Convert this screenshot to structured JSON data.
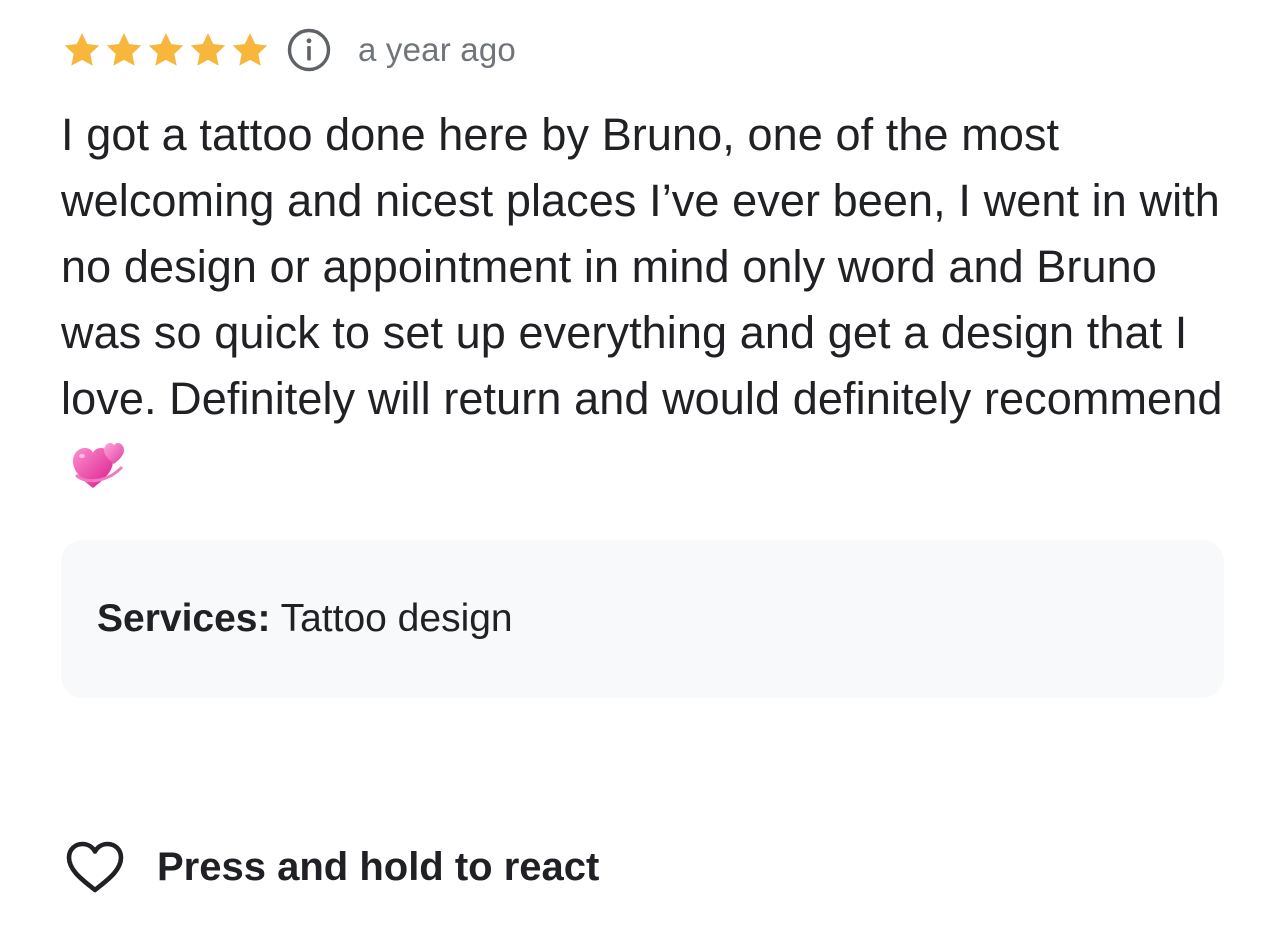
{
  "review": {
    "rating": 5,
    "rating_max": 5,
    "star_color": "#F6B73C",
    "icons": {
      "star": "star-icon",
      "info": "info-icon",
      "emoji": "revolving-hearts-emoji",
      "react": "heart-outline-icon"
    },
    "timestamp": "a year ago",
    "text": "I got a tattoo done here by Bruno, one of the most welcoming and nicest places I’ve ever been, I went in with no design or appointment in mind only word and Bruno was so quick to set up everything and get a design that I love. Definitely will return and would definitely recommend",
    "services": {
      "label": "Services:",
      "value": "Tattoo design"
    },
    "react": {
      "label": "Press and hold to react"
    }
  }
}
